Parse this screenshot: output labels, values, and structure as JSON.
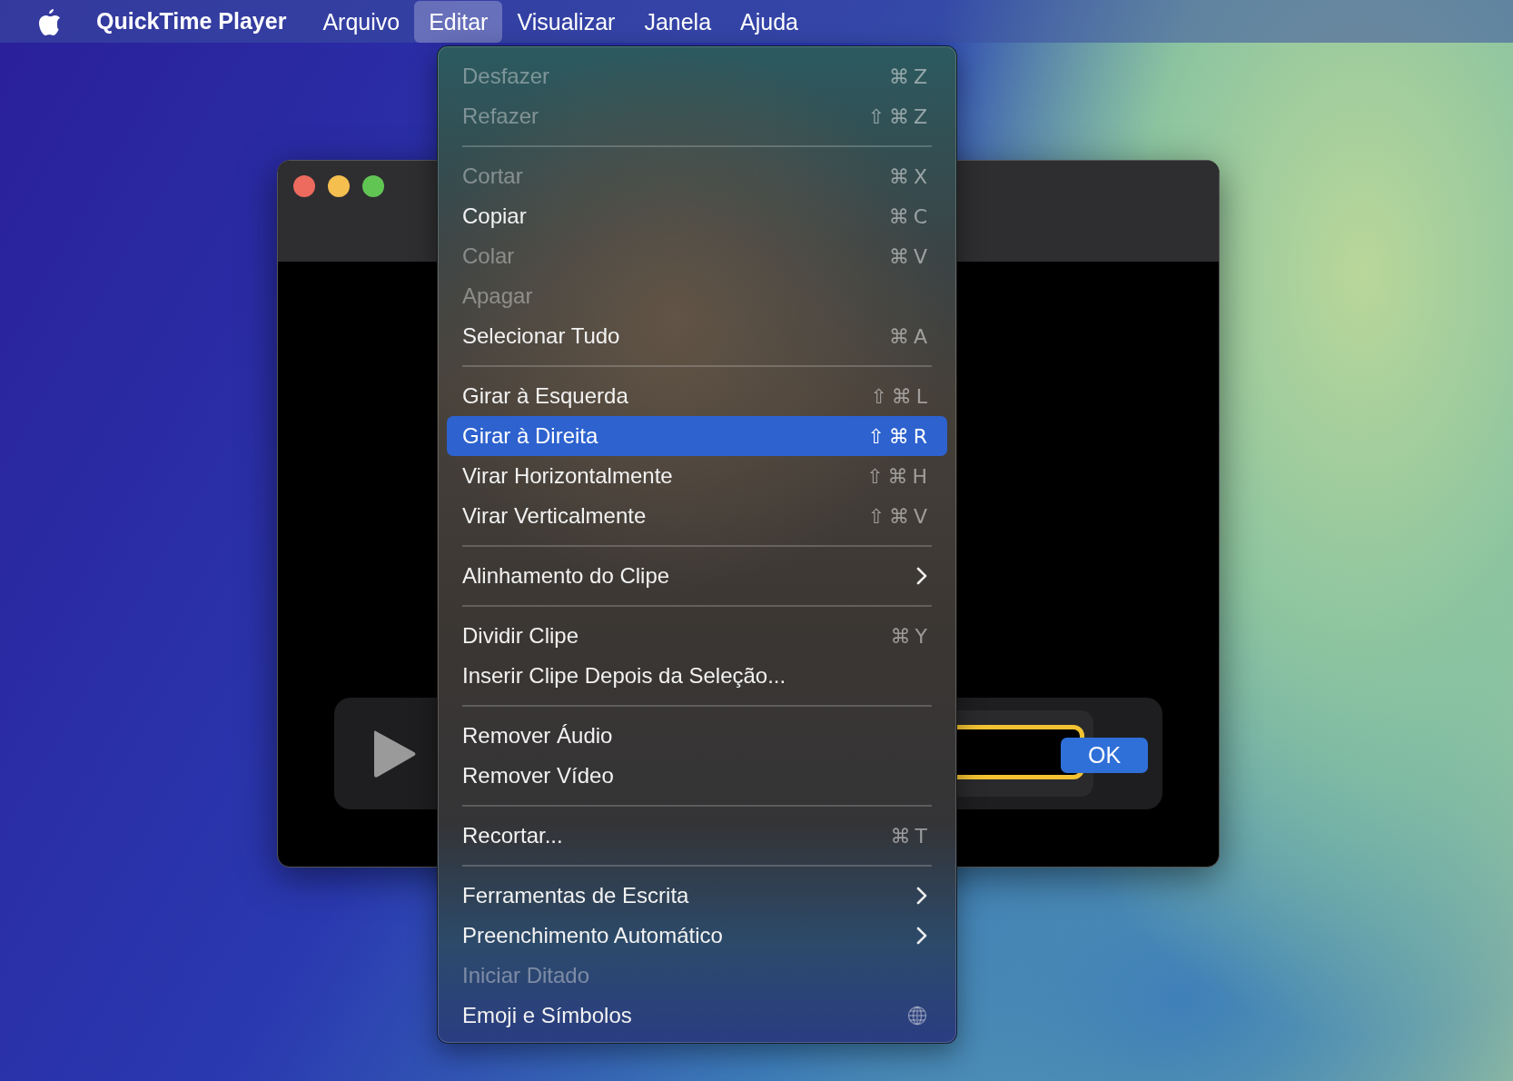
{
  "menu_bar": {
    "app_name": "QuickTime Player",
    "menus": [
      {
        "label": "Arquivo",
        "selected": false
      },
      {
        "label": "Editar",
        "selected": true
      },
      {
        "label": "Visualizar",
        "selected": false
      },
      {
        "label": "Janela",
        "selected": false
      },
      {
        "label": "Ajuda",
        "selected": false
      }
    ]
  },
  "player_window": {
    "ok_button": "OK"
  },
  "edit_menu": {
    "items": [
      {
        "kind": "command",
        "label": "Desfazer",
        "shortcut": "⌘Z",
        "disabled": true,
        "selected": false
      },
      {
        "kind": "command",
        "label": "Refazer",
        "shortcut": "⇧⌘Z",
        "disabled": true,
        "selected": false
      },
      {
        "kind": "separator"
      },
      {
        "kind": "command",
        "label": "Cortar",
        "shortcut": "⌘X",
        "disabled": true,
        "selected": false
      },
      {
        "kind": "command",
        "label": "Copiar",
        "shortcut": "⌘C",
        "disabled": false,
        "selected": false
      },
      {
        "kind": "command",
        "label": "Colar",
        "shortcut": "⌘V",
        "disabled": true,
        "selected": false
      },
      {
        "kind": "command",
        "label": "Apagar",
        "disabled": true,
        "selected": false
      },
      {
        "kind": "command",
        "label": "Selecionar Tudo",
        "shortcut": "⌘A",
        "disabled": false,
        "selected": false
      },
      {
        "kind": "separator"
      },
      {
        "kind": "command",
        "label": "Girar à Esquerda",
        "shortcut": "⇧⌘L",
        "disabled": false,
        "selected": false
      },
      {
        "kind": "command",
        "label": "Girar à Direita",
        "shortcut": "⇧⌘R",
        "disabled": false,
        "selected": true
      },
      {
        "kind": "command",
        "label": "Virar Horizontalmente",
        "shortcut": "⇧⌘H",
        "disabled": false,
        "selected": false
      },
      {
        "kind": "command",
        "label": "Virar Verticalmente",
        "shortcut": "⇧⌘V",
        "disabled": false,
        "selected": false
      },
      {
        "kind": "separator"
      },
      {
        "kind": "submenu",
        "label": "Alinhamento do Clipe",
        "disabled": false,
        "selected": false
      },
      {
        "kind": "separator"
      },
      {
        "kind": "command",
        "label": "Dividir Clipe",
        "shortcut": "⌘Y",
        "disabled": false,
        "selected": false
      },
      {
        "kind": "command",
        "label": "Inserir Clipe Depois da Seleção...",
        "disabled": false,
        "selected": false
      },
      {
        "kind": "separator"
      },
      {
        "kind": "command",
        "label": "Remover Áudio",
        "disabled": false,
        "selected": false
      },
      {
        "kind": "command",
        "label": "Remover Vídeo",
        "disabled": false,
        "selected": false
      },
      {
        "kind": "separator"
      },
      {
        "kind": "command",
        "label": "Recortar...",
        "shortcut": "⌘T",
        "disabled": false,
        "selected": false
      },
      {
        "kind": "separator"
      },
      {
        "kind": "submenu",
        "label": "Ferramentas de Escrita",
        "disabled": false,
        "selected": false
      },
      {
        "kind": "submenu",
        "label": "Preenchimento Automático",
        "disabled": false,
        "selected": false
      },
      {
        "kind": "command",
        "label": "Iniciar Ditado",
        "disabled": true,
        "selected": false
      },
      {
        "kind": "emoji",
        "label": "Emoji e Símbolos",
        "disabled": false,
        "selected": false
      }
    ]
  }
}
